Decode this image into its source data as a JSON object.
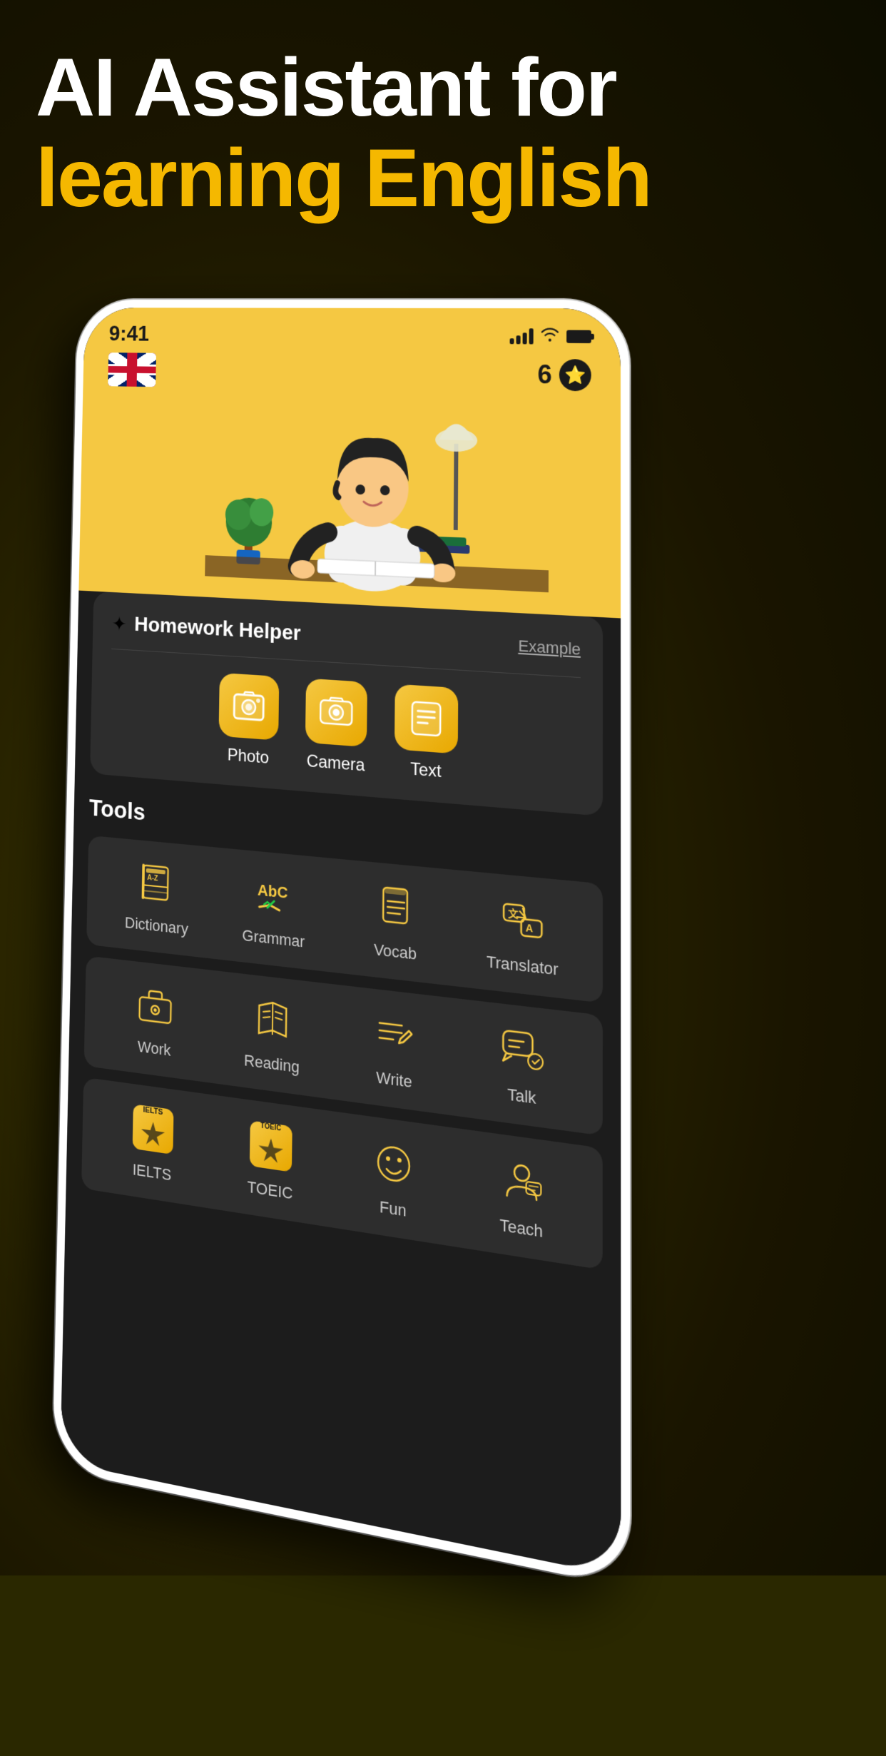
{
  "hero": {
    "line1": "AI Assistant for",
    "line2": "learning English"
  },
  "status_bar": {
    "time": "9:41",
    "points": "6"
  },
  "homework_helper": {
    "title": "Homework Helper",
    "example_label": "Example",
    "buttons": [
      {
        "id": "photo",
        "label": "Photo",
        "icon": "🖼️"
      },
      {
        "id": "camera",
        "label": "Camera",
        "icon": "📷"
      },
      {
        "id": "text",
        "label": "Text",
        "icon": "📝"
      }
    ]
  },
  "tools": {
    "section_title": "Tools",
    "row1": [
      {
        "id": "dictionary",
        "label": "Dictionary"
      },
      {
        "id": "grammar",
        "label": "Grammar"
      },
      {
        "id": "vocab",
        "label": "Vocab"
      },
      {
        "id": "translator",
        "label": "Translator"
      }
    ],
    "row2": [
      {
        "id": "work",
        "label": "Work"
      },
      {
        "id": "reading",
        "label": "Reading"
      },
      {
        "id": "write",
        "label": "Write"
      },
      {
        "id": "talk",
        "label": "Talk"
      }
    ],
    "row3": [
      {
        "id": "ielts",
        "label": "IELTS"
      },
      {
        "id": "toeic",
        "label": "TOEIC"
      },
      {
        "id": "fun",
        "label": "Fun"
      },
      {
        "id": "teach",
        "label": "Teach"
      }
    ]
  }
}
